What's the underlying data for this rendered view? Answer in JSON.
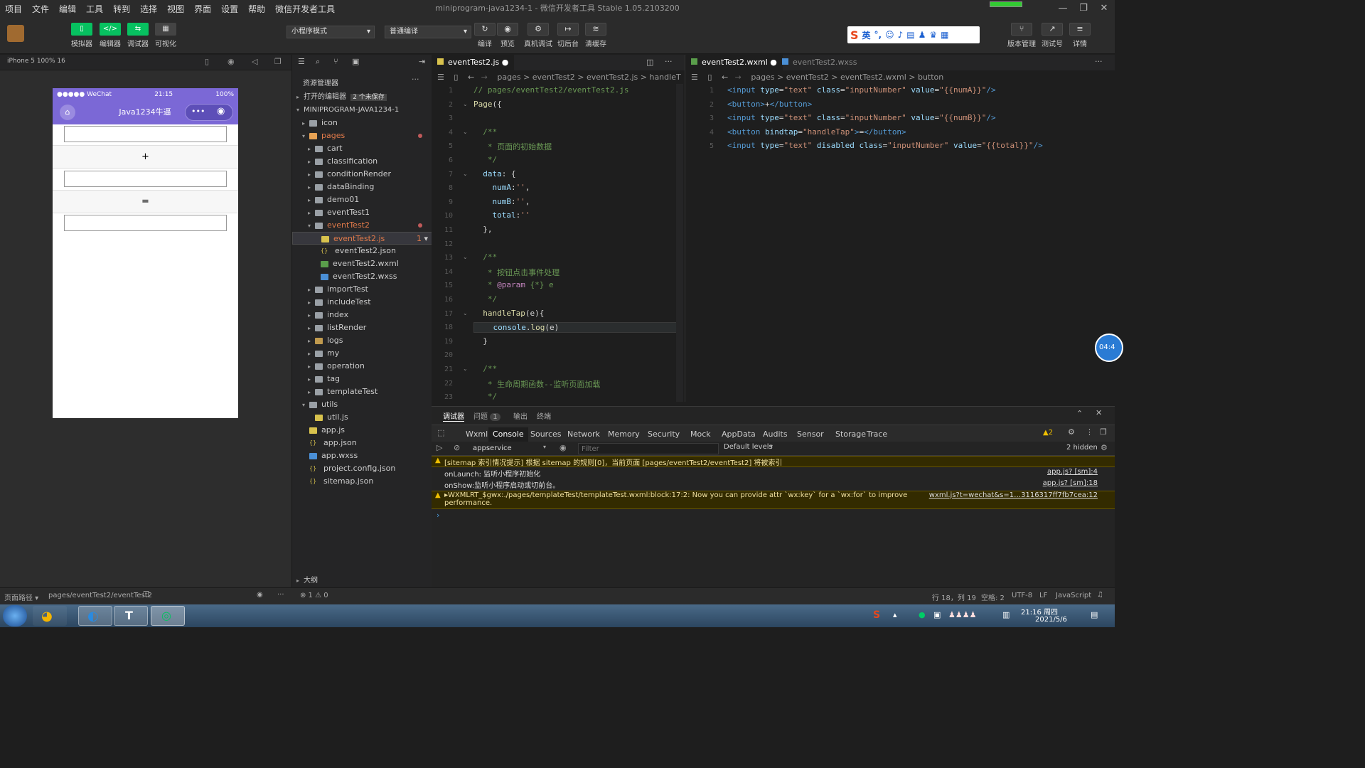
{
  "menu": [
    "项目",
    "文件",
    "编辑",
    "工具",
    "转到",
    "选择",
    "视图",
    "界面",
    "设置",
    "帮助",
    "微信开发者工具"
  ],
  "window_title": "miniprogram-java1234-1 - 微信开发者工具 Stable 1.05.2103200",
  "window_controls": [
    "—",
    "❐",
    "✕"
  ],
  "toolbar": {
    "left_buttons": [
      "模拟器",
      "编辑器",
      "调试器",
      "可视化"
    ],
    "mode_select": "小程序模式",
    "compile_select": "普通编译",
    "mid_buttons": [
      "编译",
      "预览",
      "真机调试",
      "切后台",
      "清缓存"
    ],
    "right_buttons": [
      "版本管理",
      "测试号",
      "详情"
    ],
    "ime_label": "英"
  },
  "simulator": {
    "device": "iPhone 5 100% 16",
    "status_carrier": "●●●●● WeChat",
    "status_time": "21:15",
    "status_battery": "100%",
    "nav_title": "Java1234牛逼",
    "plus_label": "+",
    "equal_label": "="
  },
  "explorer": {
    "title": "资源管理器",
    "open_editors": "打开的编辑器",
    "unsaved_badge": "2 个未保存",
    "project": "MINIPROGRAM-JAVA1234-1",
    "items": [
      {
        "label": "icon",
        "depth": 1,
        "type": "foldg",
        "arrow": "▸"
      },
      {
        "label": "pages",
        "depth": 1,
        "type": "foldo",
        "arrow": "▾",
        "dot": true,
        "orange": true
      },
      {
        "label": "cart",
        "depth": 2,
        "type": "foldg",
        "arrow": "▸"
      },
      {
        "label": "classification",
        "depth": 2,
        "type": "foldg",
        "arrow": "▸"
      },
      {
        "label": "conditionRender",
        "depth": 2,
        "type": "foldg",
        "arrow": "▸"
      },
      {
        "label": "dataBinding",
        "depth": 2,
        "type": "foldg",
        "arrow": "▸"
      },
      {
        "label": "demo01",
        "depth": 2,
        "type": "foldg",
        "arrow": "▸"
      },
      {
        "label": "eventTest1",
        "depth": 2,
        "type": "foldg",
        "arrow": "▸"
      },
      {
        "label": "eventTest2",
        "depth": 2,
        "type": "foldg",
        "arrow": "▾",
        "dot": true,
        "orange": true
      },
      {
        "label": "eventTest2.js",
        "depth": 3,
        "type": "js",
        "arrow": "",
        "sel": true,
        "orange": true,
        "count": "1"
      },
      {
        "label": "eventTest2.json",
        "depth": 3,
        "type": "json",
        "arrow": ""
      },
      {
        "label": "eventTest2.wxml",
        "depth": 3,
        "type": "wx",
        "arrow": ""
      },
      {
        "label": "eventTest2.wxss",
        "depth": 3,
        "type": "wss",
        "arrow": ""
      },
      {
        "label": "importTest",
        "depth": 2,
        "type": "foldg",
        "arrow": "▸"
      },
      {
        "label": "includeTest",
        "depth": 2,
        "type": "foldg",
        "arrow": "▸"
      },
      {
        "label": "index",
        "depth": 2,
        "type": "foldg",
        "arrow": "▸"
      },
      {
        "label": "listRender",
        "depth": 2,
        "type": "foldg",
        "arrow": "▸"
      },
      {
        "label": "logs",
        "depth": 2,
        "type": "fold",
        "arrow": "▸"
      },
      {
        "label": "my",
        "depth": 2,
        "type": "foldg",
        "arrow": "▸"
      },
      {
        "label": "operation",
        "depth": 2,
        "type": "foldg",
        "arrow": "▸"
      },
      {
        "label": "tag",
        "depth": 2,
        "type": "foldg",
        "arrow": "▸"
      },
      {
        "label": "templateTest",
        "depth": 2,
        "type": "foldg",
        "arrow": "▸"
      },
      {
        "label": "utils",
        "depth": 1,
        "type": "foldg",
        "arrow": "▾"
      },
      {
        "label": "util.js",
        "depth": 2,
        "type": "js",
        "arrow": ""
      },
      {
        "label": "app.js",
        "depth": 1,
        "type": "js",
        "arrow": ""
      },
      {
        "label": "app.json",
        "depth": 1,
        "type": "json",
        "arrow": ""
      },
      {
        "label": "app.wxss",
        "depth": 1,
        "type": "wss",
        "arrow": ""
      },
      {
        "label": "project.config.json",
        "depth": 1,
        "type": "json",
        "arrow": ""
      },
      {
        "label": "sitemap.json",
        "depth": 1,
        "type": "json",
        "arrow": ""
      }
    ],
    "outline": "大纲"
  },
  "editor1": {
    "tab": "eventTest2.js",
    "breadcrumb": "pages > eventTest2 > eventTest2.js > handleT",
    "lines": [
      [
        [
          "cm",
          "// pages/eventTest2/eventTest2.js"
        ]
      ],
      [
        [
          "fn",
          "Page"
        ],
        [
          "pn",
          "({"
        ]
      ],
      [],
      [
        [
          "cm",
          "  /**"
        ]
      ],
      [
        [
          "cm",
          "   * 页面的初始数据"
        ]
      ],
      [
        [
          "cm",
          "   */"
        ]
      ],
      [
        [
          "attr",
          "  data"
        ],
        [
          "pn",
          ": {"
        ]
      ],
      [
        [
          "attr",
          "    numA"
        ],
        [
          "pn",
          ":"
        ],
        [
          "str",
          "''"
        ],
        [
          "pn",
          ","
        ]
      ],
      [
        [
          "attr",
          "    numB"
        ],
        [
          "pn",
          ":"
        ],
        [
          "str",
          "''"
        ],
        [
          "pn",
          ","
        ]
      ],
      [
        [
          "attr",
          "    total"
        ],
        [
          "pn",
          ":"
        ],
        [
          "str",
          "''"
        ]
      ],
      [
        [
          "pn",
          "  },"
        ]
      ],
      [],
      [
        [
          "cm",
          "  /**"
        ]
      ],
      [
        [
          "cm",
          "   * 按钮点击事件处理"
        ]
      ],
      [
        [
          "cm",
          "   * "
        ],
        [
          "kw",
          "@param"
        ],
        [
          "cm",
          " {*} e"
        ]
      ],
      [
        [
          "cm",
          "   */"
        ]
      ],
      [
        [
          "fn",
          "  handleTap"
        ],
        [
          "pn",
          "(e){"
        ]
      ],
      [
        [
          "attr",
          "    console"
        ],
        [
          "pn",
          "."
        ],
        [
          "fn",
          "log"
        ],
        [
          "pn",
          "(e)"
        ]
      ],
      [
        [
          "pn",
          "  }"
        ]
      ],
      [],
      [
        [
          "cm",
          "  /**"
        ]
      ],
      [
        [
          "cm",
          "   * 生命周期函数--监听页面加载"
        ]
      ],
      [
        [
          "cm",
          "   */"
        ]
      ]
    ]
  },
  "editor2": {
    "tab": "eventTest2.wxml",
    "tab2": "eventTest2.wxss",
    "breadcrumb": "pages > eventTest2 > eventTest2.wxml > button",
    "lines": [
      [
        [
          "tag",
          "<input"
        ],
        [
          "attr",
          " type"
        ],
        [
          "pn",
          "="
        ],
        [
          "str",
          "\"text\""
        ],
        [
          "attr",
          " class"
        ],
        [
          "pn",
          "="
        ],
        [
          "str",
          "\"inputNumber\""
        ],
        [
          "attr",
          " value"
        ],
        [
          "pn",
          "="
        ],
        [
          "str",
          "\"{{numA}}\""
        ],
        [
          "tag",
          "/>"
        ]
      ],
      [
        [
          "tag",
          "<button>"
        ],
        [
          "pn",
          "+"
        ],
        [
          "tag",
          "</button>"
        ]
      ],
      [
        [
          "tag",
          "<input"
        ],
        [
          "attr",
          " type"
        ],
        [
          "pn",
          "="
        ],
        [
          "str",
          "\"text\""
        ],
        [
          "attr",
          " class"
        ],
        [
          "pn",
          "="
        ],
        [
          "str",
          "\"inputNumber\""
        ],
        [
          "attr",
          " value"
        ],
        [
          "pn",
          "="
        ],
        [
          "str",
          "\"{{numB}}\""
        ],
        [
          "tag",
          "/>"
        ]
      ],
      [
        [
          "tag",
          "<button"
        ],
        [
          "attr",
          " bindtap"
        ],
        [
          "pn",
          "="
        ],
        [
          "str",
          "\"handleTap\""
        ],
        [
          "tag",
          ">"
        ],
        [
          "pn",
          "="
        ],
        [
          "tag",
          "</button>"
        ]
      ],
      [
        [
          "tag",
          "<input"
        ],
        [
          "attr",
          " type"
        ],
        [
          "pn",
          "="
        ],
        [
          "str",
          "\"text\""
        ],
        [
          "attr",
          " disabled"
        ],
        [
          "attr",
          " class"
        ],
        [
          "pn",
          "="
        ],
        [
          "str",
          "\"inputNumber\""
        ],
        [
          "attr",
          " value"
        ],
        [
          "pn",
          "="
        ],
        [
          "str",
          "\"{{total}}\""
        ],
        [
          "tag",
          "/>"
        ]
      ]
    ]
  },
  "panel": {
    "tabs": [
      "调试器",
      "问题",
      "输出",
      "终端"
    ],
    "problem_count": "1",
    "devtabs": [
      "Wxml",
      "Console",
      "Sources",
      "Network",
      "Memory",
      "Security",
      "Mock",
      "AppData",
      "Audits",
      "Sensor",
      "Storage",
      "Trace"
    ],
    "warn_count": "▲2",
    "context": "appservice",
    "filter_placeholder": "Filter",
    "levels": "Default levels",
    "hidden": "2 hidden",
    "logs": [
      {
        "warn": true,
        "text": "[sitemap 索引情况提示] 根据 sitemap 的规则[0]，当前页面 [pages/eventTest2/eventTest2] 将被索引",
        "src": ""
      },
      {
        "warn": false,
        "text": "onLaunch: 监听小程序初始化",
        "src": "app.js? [sm]:4"
      },
      {
        "warn": false,
        "text": "onShow:监听小程序启动或切前台。",
        "src": "app.js? [sm]:18"
      },
      {
        "warn": true,
        "text": "▸WXMLRT_$gwx:./pages/templateTest/templateTest.wxml:block:17:2: Now you can provide attr `wx:key` for a `wx:for` to improve",
        "text2": "performance.",
        "src": "wxml.js?t=wechat&s=1…3116317ff7fb7cea:12"
      }
    ]
  },
  "statusbar": {
    "left": "页面路径 ▾",
    "path": "pages/eventTest2/eventTest2",
    "errors": "⊗ 1 ⚠ 0",
    "cursor": "行 18，列 19",
    "indent": "空格: 2",
    "encoding": "UTF-8",
    "eol": "LF",
    "lang": "JavaScript"
  },
  "taskbar": {
    "time": "21:16 周四",
    "date": "2021/5/6"
  },
  "float_timer": "04:4"
}
